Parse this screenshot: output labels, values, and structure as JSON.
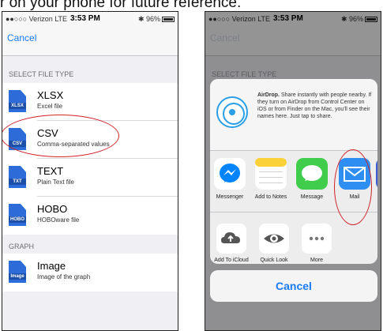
{
  "caption": "r on your phone for future reference.",
  "status_bar": {
    "carrier": "●●○○○ Verizon  LTE",
    "time": "3:53 PM",
    "battery": "✱ 96%"
  },
  "left_screen": {
    "nav": {
      "cancel_label": "Cancel"
    },
    "select_header": "SELECT FILE TYPE",
    "file_types": [
      {
        "icon": "xlsx-file-icon",
        "tag": "XLSX",
        "title": "XLSX",
        "subtitle": "Excel file"
      },
      {
        "icon": "csv-file-icon",
        "tag": "CSV",
        "title": "CSV",
        "subtitle": "Comma-separated values"
      },
      {
        "icon": "text-file-icon",
        "tag": "TXT",
        "title": "TEXT",
        "subtitle": "Plain Text file"
      },
      {
        "icon": "hobo-file-icon",
        "tag": "HOBO",
        "title": "HOBO",
        "subtitle": "HOBOware file"
      }
    ],
    "graph_header": "GRAPH",
    "graph_item": {
      "icon": "image-file-icon",
      "tag": "Image",
      "title": "Image",
      "subtitle": "Image of the graph"
    }
  },
  "right_screen": {
    "nav": {
      "cancel_label": "Cancel"
    },
    "select_header": "SELECT FILE TYPE",
    "airdrop": {
      "title": "AirDrop.",
      "text": " Share instantly with people nearby. If they turn on AirDrop from Control Center on iOS or from Finder on the Mac, you'll see their names here. Just tap to share."
    },
    "apps": [
      {
        "icon": "messenger-icon",
        "label": "Messenger",
        "color": "#0084ff"
      },
      {
        "icon": "notes-icon",
        "label": "Add to Notes",
        "color": "#fbd13a"
      },
      {
        "icon": "message-icon",
        "label": "Message",
        "color": "#3fcd4b"
      },
      {
        "icon": "mail-icon",
        "label": "Mail",
        "color": "#2e8ef1"
      }
    ],
    "actions": [
      {
        "icon": "icloud-upload-icon",
        "label": "Add To iCloud Drive"
      },
      {
        "icon": "eye-icon",
        "label": "Quick Look"
      },
      {
        "icon": "more-icon",
        "label": "More"
      }
    ],
    "cancel_label": "Cancel"
  },
  "colors": {
    "ios_blue": "#1a7cf5",
    "highlight_red": "#d0232a",
    "file_icon_blue": "#2c6bd8"
  }
}
